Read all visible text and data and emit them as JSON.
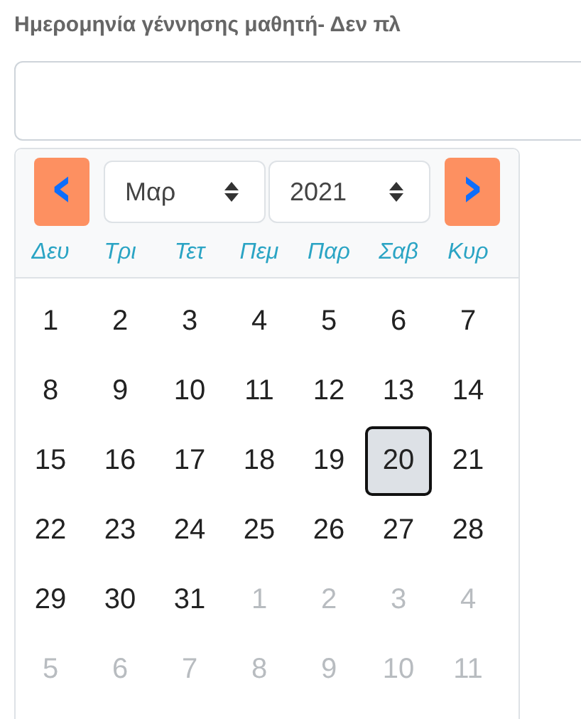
{
  "field": {
    "label": "Ημερομηνία γέννησης μαθητή- Δεν πλ"
  },
  "calendar": {
    "prev_button": "‹",
    "next_button": "›",
    "month": "Μαρ",
    "year": "2021",
    "weekdays": [
      "Δευ",
      "Τρι",
      "Τετ",
      "Πεμ",
      "Παρ",
      "Σαβ",
      "Κυρ"
    ],
    "days": [
      {
        "label": "1",
        "muted": false,
        "selected": false
      },
      {
        "label": "2",
        "muted": false,
        "selected": false
      },
      {
        "label": "3",
        "muted": false,
        "selected": false
      },
      {
        "label": "4",
        "muted": false,
        "selected": false
      },
      {
        "label": "5",
        "muted": false,
        "selected": false
      },
      {
        "label": "6",
        "muted": false,
        "selected": false
      },
      {
        "label": "7",
        "muted": false,
        "selected": false
      },
      {
        "label": "8",
        "muted": false,
        "selected": false
      },
      {
        "label": "9",
        "muted": false,
        "selected": false
      },
      {
        "label": "10",
        "muted": false,
        "selected": false
      },
      {
        "label": "11",
        "muted": false,
        "selected": false
      },
      {
        "label": "12",
        "muted": false,
        "selected": false
      },
      {
        "label": "13",
        "muted": false,
        "selected": false
      },
      {
        "label": "14",
        "muted": false,
        "selected": false
      },
      {
        "label": "15",
        "muted": false,
        "selected": false
      },
      {
        "label": "16",
        "muted": false,
        "selected": false
      },
      {
        "label": "17",
        "muted": false,
        "selected": false
      },
      {
        "label": "18",
        "muted": false,
        "selected": false
      },
      {
        "label": "19",
        "muted": false,
        "selected": false
      },
      {
        "label": "20",
        "muted": false,
        "selected": true
      },
      {
        "label": "21",
        "muted": false,
        "selected": false
      },
      {
        "label": "22",
        "muted": false,
        "selected": false
      },
      {
        "label": "23",
        "muted": false,
        "selected": false
      },
      {
        "label": "24",
        "muted": false,
        "selected": false
      },
      {
        "label": "25",
        "muted": false,
        "selected": false
      },
      {
        "label": "26",
        "muted": false,
        "selected": false
      },
      {
        "label": "27",
        "muted": false,
        "selected": false
      },
      {
        "label": "28",
        "muted": false,
        "selected": false
      },
      {
        "label": "29",
        "muted": false,
        "selected": false
      },
      {
        "label": "30",
        "muted": false,
        "selected": false
      },
      {
        "label": "31",
        "muted": false,
        "selected": false
      },
      {
        "label": "1",
        "muted": true,
        "selected": false
      },
      {
        "label": "2",
        "muted": true,
        "selected": false
      },
      {
        "label": "3",
        "muted": true,
        "selected": false
      },
      {
        "label": "4",
        "muted": true,
        "selected": false
      },
      {
        "label": "5",
        "muted": true,
        "selected": false
      },
      {
        "label": "6",
        "muted": true,
        "selected": false
      },
      {
        "label": "7",
        "muted": true,
        "selected": false
      },
      {
        "label": "8",
        "muted": true,
        "selected": false
      },
      {
        "label": "9",
        "muted": true,
        "selected": false
      },
      {
        "label": "10",
        "muted": true,
        "selected": false
      },
      {
        "label": "11",
        "muted": true,
        "selected": false
      }
    ]
  }
}
